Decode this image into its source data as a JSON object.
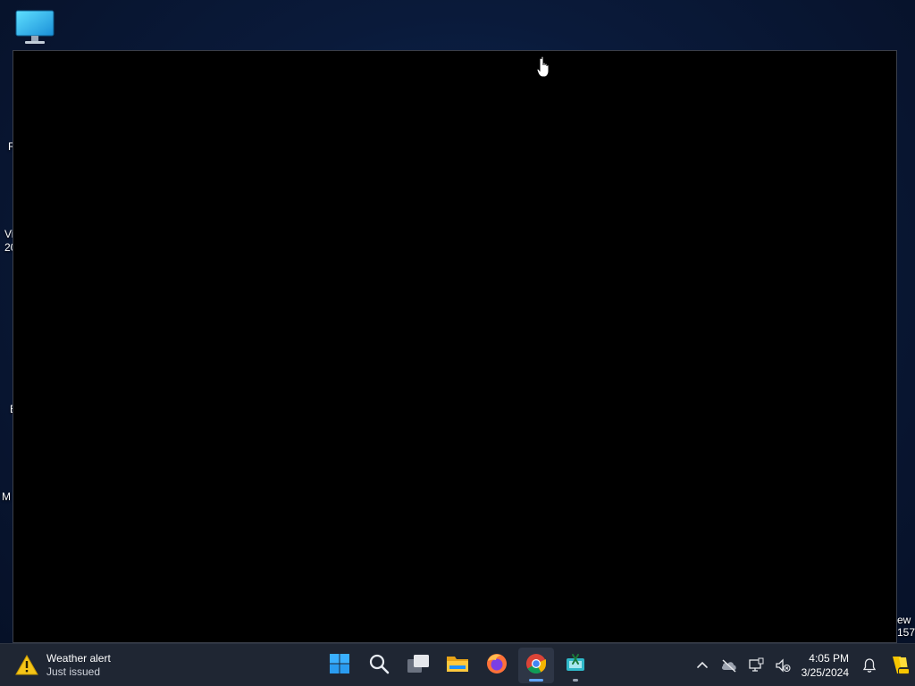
{
  "desktop": {
    "icons": [
      {
        "name": "this-pc-icon"
      }
    ],
    "edge_labels_left": [
      "R",
      "Vi",
      "20",
      "E",
      "M"
    ],
    "edge_labels_right": [
      "ew",
      "157"
    ]
  },
  "taskbar": {
    "weather": {
      "title": "Weather alert",
      "subtitle": "Just issued",
      "icon": "warning-icon",
      "icon_color": "#f5c518"
    },
    "apps": [
      {
        "name": "start",
        "icon": "windows-logo-icon",
        "state": "normal"
      },
      {
        "name": "search",
        "icon": "search-icon",
        "state": "normal"
      },
      {
        "name": "task-view",
        "icon": "task-view-icon",
        "state": "normal"
      },
      {
        "name": "file-explorer",
        "icon": "folder-icon",
        "state": "normal"
      },
      {
        "name": "firefox",
        "icon": "firefox-icon",
        "state": "normal"
      },
      {
        "name": "chrome",
        "icon": "chrome-icon",
        "state": "active"
      },
      {
        "name": "snipping",
        "icon": "snipping-tool-icon",
        "state": "running"
      }
    ],
    "tray": {
      "icons": [
        "chevron-up-icon",
        "onedrive-offline-icon",
        "network-icon",
        "volume-muted-icon"
      ],
      "time": "4:05 PM",
      "date": "3/25/2024"
    }
  },
  "colors": {
    "taskbar_bg": "#1f2633",
    "accent": "#60a5fa",
    "window_bg": "#000000"
  }
}
